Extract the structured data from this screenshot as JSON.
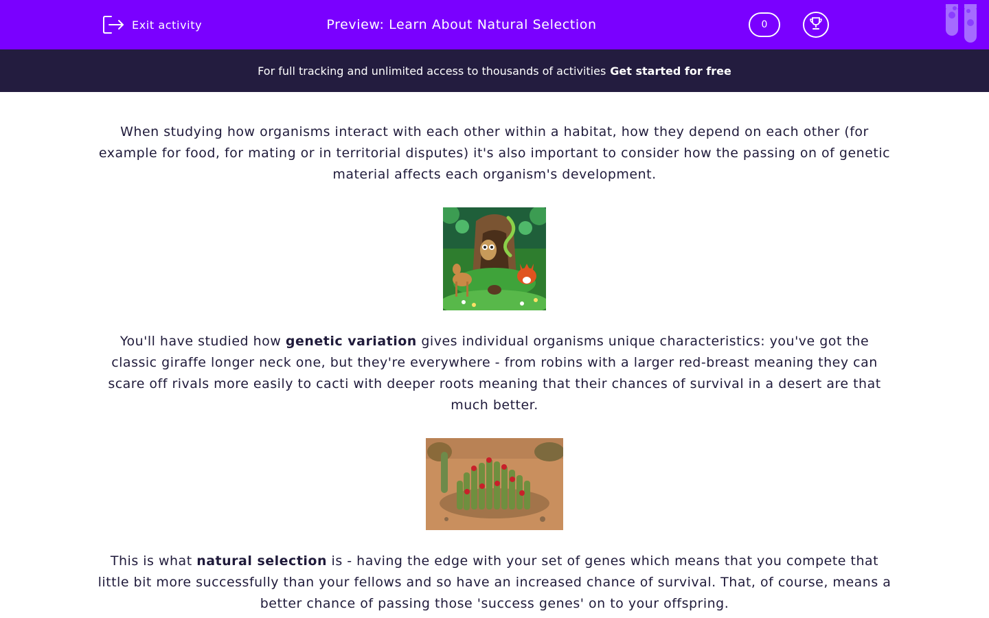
{
  "header": {
    "exit_label": "Exit activity",
    "title": "Preview: Learn About Natural Selection",
    "score": "0",
    "background_color": "#7a00ff"
  },
  "promo": {
    "text": "For full tracking and unlimited access to thousands of activities",
    "link": "Get started for free",
    "background_color": "#231c3f"
  },
  "content": {
    "p1": "When studying how organisms interact with each other within a habitat, how they depend on each other (for example for food, for mating or in territorial disputes) it's also important to consider how the passing on of genetic material affects each organism's development.",
    "p2_before": "You'll have studied how ",
    "p2_bold": "genetic variation",
    "p2_after": " gives individual organisms unique characteristics: you've got the classic giraffe longer neck one, but they're everywhere - from robins with a larger red-breast meaning they can scare off rivals more easily to cacti with deeper roots meaning that their chances of survival in a desert are that much better.",
    "p3_before": "This is what ",
    "p3_bold": "natural selection",
    "p3_after": " is - having the edge with your set of genes which means that you compete that little bit more successfully than your fellows and so have an increased chance of survival. That, of course, means a better chance of passing those 'success genes' on to your offspring."
  },
  "icons": {
    "exit": "exit-icon",
    "trophy": "trophy-icon",
    "tubes": "test-tubes-icon"
  }
}
